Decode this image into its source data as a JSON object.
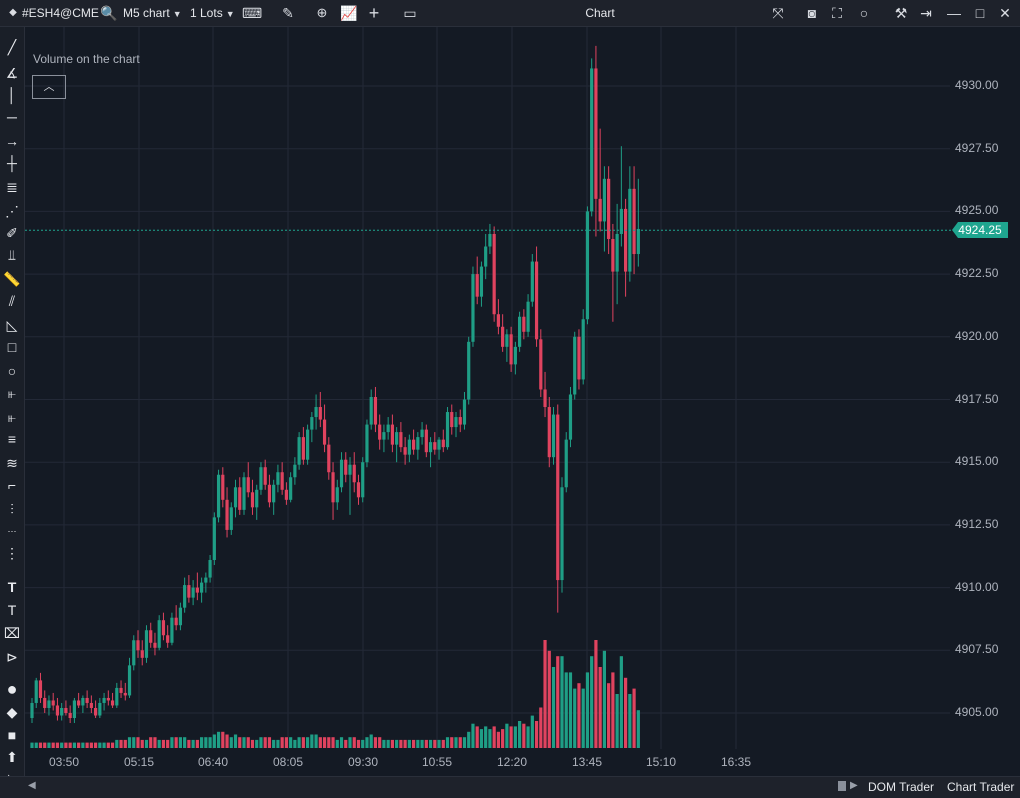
{
  "window": {
    "title": "Chart"
  },
  "topbar": {
    "symbol": "#ESH4@CME",
    "chart_type": "M5 chart",
    "lots": "1 Lots"
  },
  "overlay": {
    "volume_label": "Volume on the chart"
  },
  "chart_data": {
    "type": "candlestick",
    "title": "",
    "y_ticks": [
      "4905.00",
      "4907.50",
      "4910.00",
      "4912.50",
      "4915.00",
      "4917.50",
      "4920.00",
      "4922.50",
      "4925.00",
      "4927.50",
      "4930.00"
    ],
    "y_range": [
      4904.0,
      4932.5
    ],
    "x_ticks": [
      "03:50",
      "05:15",
      "06:40",
      "08:05",
      "09:30",
      "10:55",
      "12:20",
      "13:45",
      "15:10",
      "16:35"
    ],
    "current_price": "4924.25",
    "colors": {
      "up": "#1f9e86",
      "down": "#e0435f",
      "grid": "#232937",
      "current_line": "#1fa58f"
    },
    "ohlc": [
      [
        4904.8,
        4905.6,
        4904.6,
        4905.4
      ],
      [
        4905.4,
        4906.4,
        4905.2,
        4906.3
      ],
      [
        4906.3,
        4906.6,
        4905.4,
        4905.6
      ],
      [
        4905.6,
        4905.9,
        4905.0,
        4905.2
      ],
      [
        4905.2,
        4905.7,
        4904.9,
        4905.5
      ],
      [
        4905.5,
        4905.8,
        4905.1,
        4905.3
      ],
      [
        4905.3,
        4905.6,
        4904.7,
        4904.9
      ],
      [
        4904.9,
        4905.4,
        4904.7,
        4905.2
      ],
      [
        4905.2,
        4905.5,
        4904.9,
        4905.0
      ],
      [
        4905.0,
        4905.3,
        4904.6,
        4904.8
      ],
      [
        4904.8,
        4905.6,
        4904.6,
        4905.5
      ],
      [
        4905.5,
        4905.8,
        4905.2,
        4905.3
      ],
      [
        4905.3,
        4905.7,
        4905.0,
        4905.6
      ],
      [
        4905.6,
        4905.9,
        4905.2,
        4905.4
      ],
      [
        4905.4,
        4905.7,
        4905.0,
        4905.2
      ],
      [
        4905.2,
        4905.5,
        4904.8,
        4904.9
      ],
      [
        4904.9,
        4905.6,
        4904.8,
        4905.4
      ],
      [
        4905.4,
        4905.8,
        4905.1,
        4905.6
      ],
      [
        4905.6,
        4905.9,
        4905.3,
        4905.5
      ],
      [
        4905.5,
        4905.8,
        4905.2,
        4905.3
      ],
      [
        4905.3,
        4906.2,
        4905.2,
        4906.0
      ],
      [
        4906.0,
        4906.3,
        4905.6,
        4905.8
      ],
      [
        4905.8,
        4906.2,
        4905.5,
        4905.7
      ],
      [
        4905.7,
        4907.2,
        4905.6,
        4906.9
      ],
      [
        4906.9,
        4908.1,
        4906.7,
        4907.9
      ],
      [
        4907.9,
        4908.3,
        4907.2,
        4907.5
      ],
      [
        4907.5,
        4907.9,
        4906.9,
        4907.2
      ],
      [
        4907.2,
        4908.5,
        4907.0,
        4908.3
      ],
      [
        4908.3,
        4908.6,
        4907.6,
        4907.8
      ],
      [
        4907.8,
        4908.2,
        4907.3,
        4907.6
      ],
      [
        4907.6,
        4908.9,
        4907.5,
        4908.7
      ],
      [
        4908.7,
        4909.0,
        4907.9,
        4908.1
      ],
      [
        4908.1,
        4908.5,
        4907.6,
        4907.8
      ],
      [
        4907.8,
        4909.0,
        4907.7,
        4908.8
      ],
      [
        4908.8,
        4909.3,
        4908.3,
        4908.5
      ],
      [
        4908.5,
        4909.4,
        4908.3,
        4909.2
      ],
      [
        4909.2,
        4910.4,
        4909.0,
        4910.1
      ],
      [
        4910.1,
        4910.5,
        4909.4,
        4909.6
      ],
      [
        4909.6,
        4910.3,
        4909.3,
        4910.0
      ],
      [
        4910.0,
        4910.6,
        4909.5,
        4909.8
      ],
      [
        4909.8,
        4910.4,
        4909.4,
        4910.2
      ],
      [
        4910.2,
        4910.6,
        4909.8,
        4910.4
      ],
      [
        4910.4,
        4911.3,
        4910.2,
        4911.1
      ],
      [
        4911.1,
        4913.0,
        4910.9,
        4912.8
      ],
      [
        4912.8,
        4914.7,
        4912.6,
        4914.5
      ],
      [
        4914.5,
        4914.8,
        4913.2,
        4913.5
      ],
      [
        4913.5,
        4914.0,
        4912.0,
        4912.3
      ],
      [
        4912.3,
        4913.4,
        4912.1,
        4913.2
      ],
      [
        4913.2,
        4914.3,
        4912.8,
        4914.0
      ],
      [
        4914.0,
        4914.4,
        4912.9,
        4913.1
      ],
      [
        4913.1,
        4914.6,
        4912.9,
        4914.4
      ],
      [
        4914.4,
        4915.0,
        4913.6,
        4913.8
      ],
      [
        4913.8,
        4914.3,
        4912.9,
        4913.2
      ],
      [
        4913.2,
        4914.1,
        4912.7,
        4913.9
      ],
      [
        4913.9,
        4915.0,
        4913.7,
        4914.8
      ],
      [
        4914.8,
        4915.1,
        4913.9,
        4914.1
      ],
      [
        4914.1,
        4914.5,
        4913.2,
        4913.4
      ],
      [
        4913.4,
        4914.3,
        4912.9,
        4914.1
      ],
      [
        4914.1,
        4914.9,
        4913.8,
        4914.6
      ],
      [
        4914.6,
        4915.0,
        4913.7,
        4913.9
      ],
      [
        4913.9,
        4914.2,
        4913.3,
        4913.5
      ],
      [
        4913.5,
        4914.6,
        4913.4,
        4914.4
      ],
      [
        4914.4,
        4915.2,
        4914.1,
        4914.9
      ],
      [
        4914.9,
        4916.2,
        4914.7,
        4916.0
      ],
      [
        4916.0,
        4916.4,
        4914.9,
        4915.1
      ],
      [
        4915.1,
        4916.5,
        4914.9,
        4916.3
      ],
      [
        4916.3,
        4917.0,
        4915.8,
        4916.8
      ],
      [
        4916.8,
        4917.7,
        4916.3,
        4917.2
      ],
      [
        4917.2,
        4917.8,
        4916.4,
        4916.7
      ],
      [
        4916.7,
        4917.3,
        4915.4,
        4915.7
      ],
      [
        4915.7,
        4916.0,
        4914.3,
        4914.6
      ],
      [
        4914.6,
        4915.0,
        4912.7,
        4913.4
      ],
      [
        4913.4,
        4914.3,
        4913.1,
        4914.0
      ],
      [
        4914.0,
        4915.4,
        4913.8,
        4915.1
      ],
      [
        4915.1,
        4915.4,
        4914.2,
        4914.5
      ],
      [
        4914.5,
        4915.2,
        4912.9,
        4914.9
      ],
      [
        4914.9,
        4915.4,
        4913.8,
        4914.2
      ],
      [
        4914.2,
        4914.5,
        4913.3,
        4913.6
      ],
      [
        4913.6,
        4915.2,
        4913.4,
        4915.0
      ],
      [
        4915.0,
        4916.7,
        4914.8,
        4916.5
      ],
      [
        4916.5,
        4917.9,
        4916.3,
        4917.6
      ],
      [
        4917.6,
        4918.0,
        4916.2,
        4916.5
      ],
      [
        4916.5,
        4916.9,
        4915.5,
        4915.9
      ],
      [
        4915.9,
        4916.5,
        4915.4,
        4916.2
      ],
      [
        4916.2,
        4916.8,
        4915.9,
        4916.5
      ],
      [
        4916.5,
        4916.9,
        4915.4,
        4915.7
      ],
      [
        4915.7,
        4916.4,
        4915.0,
        4916.2
      ],
      [
        4916.2,
        4916.6,
        4915.4,
        4915.6
      ],
      [
        4915.6,
        4916.0,
        4914.9,
        4915.3
      ],
      [
        4915.3,
        4916.1,
        4915.0,
        4915.9
      ],
      [
        4915.9,
        4916.3,
        4915.3,
        4915.5
      ],
      [
        4915.5,
        4916.2,
        4915.1,
        4916.0
      ],
      [
        4916.0,
        4916.6,
        4915.7,
        4916.3
      ],
      [
        4916.3,
        4916.5,
        4915.2,
        4915.4
      ],
      [
        4915.4,
        4916.0,
        4914.8,
        4915.8
      ],
      [
        4915.8,
        4916.2,
        4915.3,
        4915.5
      ],
      [
        4915.5,
        4916.0,
        4915.1,
        4915.9
      ],
      [
        4915.9,
        4916.3,
        4915.4,
        4915.6
      ],
      [
        4915.6,
        4917.2,
        4915.5,
        4917.0
      ],
      [
        4917.0,
        4917.3,
        4916.1,
        4916.4
      ],
      [
        4916.4,
        4917.0,
        4916.0,
        4916.8
      ],
      [
        4916.8,
        4917.1,
        4916.2,
        4916.5
      ],
      [
        4916.5,
        4917.8,
        4916.3,
        4917.5
      ],
      [
        4917.5,
        4920.0,
        4917.3,
        4919.8
      ],
      [
        4919.8,
        4922.8,
        4919.6,
        4922.5
      ],
      [
        4922.5,
        4923.2,
        4921.3,
        4921.6
      ],
      [
        4921.6,
        4923.0,
        4921.2,
        4922.8
      ],
      [
        4922.8,
        4924.1,
        4922.3,
        4923.6
      ],
      [
        4923.6,
        4924.5,
        4923.3,
        4924.1
      ],
      [
        4924.1,
        4924.4,
        4920.6,
        4920.9
      ],
      [
        4920.9,
        4921.5,
        4920.1,
        4920.4
      ],
      [
        4920.4,
        4920.9,
        4919.4,
        4919.6
      ],
      [
        4919.6,
        4920.3,
        4919.0,
        4920.1
      ],
      [
        4920.1,
        4920.4,
        4918.6,
        4918.9
      ],
      [
        4918.9,
        4919.8,
        4918.5,
        4919.6
      ],
      [
        4919.6,
        4921.0,
        4919.4,
        4920.8
      ],
      [
        4920.8,
        4921.1,
        4919.9,
        4920.2
      ],
      [
        4920.2,
        4921.7,
        4920.0,
        4921.4
      ],
      [
        4921.4,
        4923.3,
        4921.2,
        4923.0
      ],
      [
        4923.0,
        4923.6,
        4919.6,
        4919.9
      ],
      [
        4919.9,
        4920.3,
        4917.6,
        4917.9
      ],
      [
        4917.9,
        4918.6,
        4916.8,
        4917.2
      ],
      [
        4917.2,
        4917.6,
        4914.8,
        4915.2
      ],
      [
        4915.2,
        4917.2,
        4914.9,
        4916.9
      ],
      [
        4916.9,
        4917.3,
        4909.0,
        4910.3
      ],
      [
        4910.3,
        4914.4,
        4909.8,
        4914.0
      ],
      [
        4914.0,
        4916.2,
        4913.8,
        4915.9
      ],
      [
        4915.9,
        4918.0,
        4915.6,
        4917.7
      ],
      [
        4917.7,
        4920.2,
        4917.5,
        4920.0
      ],
      [
        4920.0,
        4920.3,
        4917.9,
        4918.3
      ],
      [
        4918.3,
        4921.1,
        4918.1,
        4920.7
      ],
      [
        4920.7,
        4925.2,
        4920.5,
        4925.0
      ],
      [
        4925.0,
        4931.1,
        4924.8,
        4930.7
      ],
      [
        4930.7,
        4931.6,
        4924.0,
        4925.5
      ],
      [
        4925.5,
        4928.3,
        4924.2,
        4924.6
      ],
      [
        4924.6,
        4926.8,
        4923.4,
        4926.3
      ],
      [
        4926.3,
        4926.8,
        4923.3,
        4923.9
      ],
      [
        4923.9,
        4924.5,
        4920.6,
        4922.6
      ],
      [
        4922.6,
        4925.3,
        4921.3,
        4924.1
      ],
      [
        4924.1,
        4927.6,
        4923.6,
        4925.1
      ],
      [
        4925.1,
        4925.5,
        4921.6,
        4922.6
      ],
      [
        4922.6,
        4926.8,
        4922.2,
        4925.9
      ],
      [
        4925.9,
        4926.8,
        4922.5,
        4923.3
      ],
      [
        4923.3,
        4926.3,
        4922.8,
        4924.3
      ]
    ],
    "volume": [
      2,
      2,
      2,
      2,
      2,
      2,
      2,
      2,
      2,
      2,
      2,
      2,
      2,
      2,
      2,
      2,
      2,
      2,
      2,
      2,
      3,
      3,
      3,
      4,
      4,
      4,
      3,
      3,
      4,
      4,
      3,
      3,
      3,
      4,
      4,
      4,
      4,
      3,
      3,
      3,
      4,
      4,
      4,
      5,
      6,
      6,
      5,
      4,
      5,
      4,
      4,
      4,
      3,
      3,
      4,
      4,
      4,
      3,
      3,
      4,
      4,
      4,
      3,
      4,
      4,
      4,
      5,
      5,
      4,
      4,
      4,
      4,
      3,
      4,
      3,
      4,
      4,
      3,
      3,
      4,
      5,
      4,
      4,
      3,
      3,
      3,
      3,
      3,
      3,
      3,
      3,
      3,
      3,
      3,
      3,
      3,
      3,
      3,
      4,
      4,
      4,
      4,
      4,
      6,
      9,
      8,
      7,
      8,
      7,
      8,
      6,
      7,
      9,
      8,
      8,
      10,
      9,
      8,
      12,
      10,
      15,
      40,
      36,
      30,
      34,
      34,
      28,
      28,
      22,
      24,
      22,
      28,
      34,
      40,
      30,
      36,
      24,
      28,
      20,
      34,
      26,
      20,
      22,
      14
    ]
  },
  "bottombar": {
    "dom_trader": "DOM Trader",
    "chart_trader": "Chart Trader"
  }
}
